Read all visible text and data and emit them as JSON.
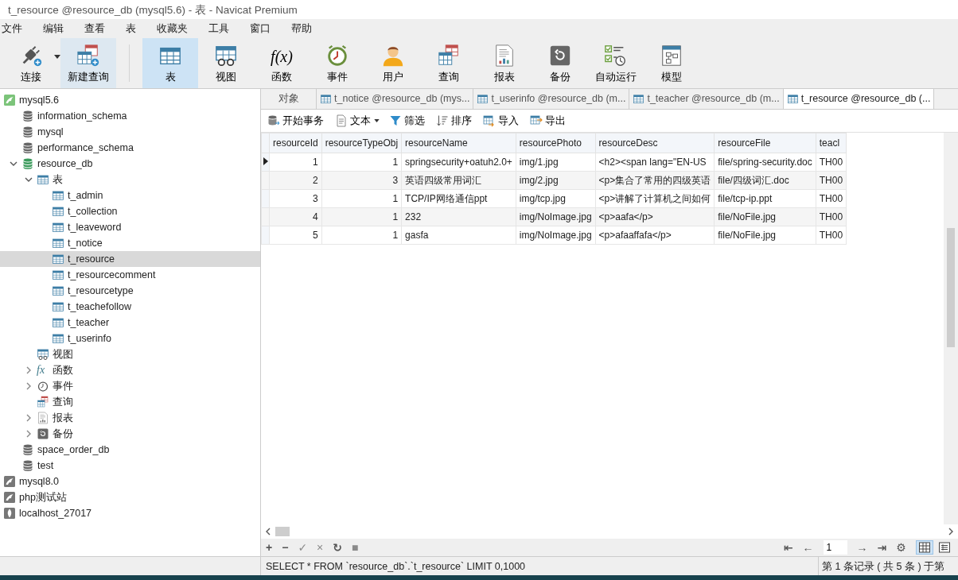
{
  "window": {
    "title": "t_resource @resource_db (mysql5.6) - 表 - Navicat Premium"
  },
  "menu": [
    "文件",
    "编辑",
    "查看",
    "表",
    "收藏夹",
    "工具",
    "窗口",
    "帮助"
  ],
  "toolbar": [
    {
      "kind": "connect",
      "label": "连接",
      "selected": false,
      "dropdown": true
    },
    {
      "kind": "newquery",
      "label": "新建查询",
      "selected": false,
      "highlighted": true
    },
    {
      "kind": "table",
      "label": "表",
      "selected": true
    },
    {
      "kind": "view",
      "label": "视图",
      "selected": false
    },
    {
      "kind": "function",
      "label": "函数",
      "selected": false,
      "glyph": "f(x)"
    },
    {
      "kind": "event",
      "label": "事件",
      "selected": false
    },
    {
      "kind": "user",
      "label": "用户",
      "selected": false
    },
    {
      "kind": "query",
      "label": "查询",
      "selected": false
    },
    {
      "kind": "report",
      "label": "报表",
      "selected": false
    },
    {
      "kind": "backup",
      "label": "备份",
      "selected": false
    },
    {
      "kind": "autorun",
      "label": "自动运行",
      "selected": false
    },
    {
      "kind": "model",
      "label": "模型",
      "selected": false
    }
  ],
  "sidebar": {
    "tree": [
      {
        "kind": "connection",
        "label": "mysql5.6",
        "selected": false,
        "children": [
          {
            "kind": "database",
            "label": "information_schema",
            "selected": false
          },
          {
            "kind": "database",
            "label": "mysql",
            "selected": false
          },
          {
            "kind": "database",
            "label": "performance_schema",
            "selected": false
          },
          {
            "kind": "database",
            "label": "resource_db",
            "selected": false,
            "expanded": true,
            "open": true,
            "children": [
              {
                "kind": "tables",
                "label": "表",
                "selected": false,
                "expanded": true,
                "children": [
                  {
                    "kind": "table",
                    "label": "t_admin",
                    "selected": false
                  },
                  {
                    "kind": "table",
                    "label": "t_collection",
                    "selected": false
                  },
                  {
                    "kind": "table",
                    "label": "t_leaveword",
                    "selected": false
                  },
                  {
                    "kind": "table",
                    "label": "t_notice",
                    "selected": false
                  },
                  {
                    "kind": "table",
                    "label": "t_resource",
                    "selected": true
                  },
                  {
                    "kind": "table",
                    "label": "t_resourcecomment",
                    "selected": false
                  },
                  {
                    "kind": "table",
                    "label": "t_resourcetype",
                    "selected": false
                  },
                  {
                    "kind": "table",
                    "label": "t_teachefollow",
                    "selected": false
                  },
                  {
                    "kind": "table",
                    "label": "t_teacher",
                    "selected": false
                  },
                  {
                    "kind": "table",
                    "label": "t_userinfo",
                    "selected": false
                  }
                ]
              },
              {
                "kind": "views",
                "label": "视图",
                "selected": false
              },
              {
                "kind": "functions",
                "label": "函数",
                "selected": false,
                "expanded": false,
                "glyph": "fx"
              },
              {
                "kind": "events",
                "label": "事件",
                "selected": false,
                "expanded": false
              },
              {
                "kind": "queries",
                "label": "查询",
                "selected": false
              },
              {
                "kind": "reports",
                "label": "报表",
                "selected": false,
                "expanded": false
              },
              {
                "kind": "backups",
                "label": "备份",
                "selected": false,
                "expanded": false
              }
            ]
          },
          {
            "kind": "database",
            "label": "space_order_db",
            "selected": false
          },
          {
            "kind": "database",
            "label": "test",
            "selected": false
          }
        ]
      },
      {
        "kind": "connection-off",
        "label": "mysql8.0",
        "selected": false
      },
      {
        "kind": "connection-off",
        "label": "php测试站",
        "selected": false
      },
      {
        "kind": "mongo",
        "label": "localhost_27017",
        "selected": false
      }
    ]
  },
  "tabs": [
    {
      "kind": "objects",
      "label": "对象",
      "selected": false
    },
    {
      "kind": "table",
      "label": "t_notice @resource_db (mys...",
      "selected": false
    },
    {
      "kind": "table",
      "label": "t_userinfo @resource_db (m...",
      "selected": false
    },
    {
      "kind": "table",
      "label": "t_teacher @resource_db (m...",
      "selected": false
    },
    {
      "kind": "table",
      "label": "t_resource @resource_db (...",
      "selected": true
    }
  ],
  "subtoolbar": [
    {
      "kind": "transaction",
      "label": "开始事务"
    },
    {
      "kind": "text",
      "label": "文本",
      "dropdown": true
    },
    {
      "kind": "filter",
      "label": "筛选"
    },
    {
      "kind": "sort",
      "label": "排序"
    },
    {
      "kind": "import",
      "label": "导入"
    },
    {
      "kind": "export",
      "label": "导出"
    }
  ],
  "table": {
    "columns": [
      "resourceId",
      "resourceTypeObj",
      "resourceName",
      "resourcePhoto",
      "resourceDesc",
      "resourceFile",
      "teacl"
    ],
    "numeric": [
      true,
      true,
      false,
      false,
      false,
      false,
      false
    ],
    "rows": [
      {
        "current": true,
        "cells": [
          "1",
          "1",
          "springsecurity+oatuh2.0+",
          "img/1.jpg",
          "<h2><span lang=\"EN-US",
          "file/spring-security.doc",
          "TH00"
        ]
      },
      {
        "current": false,
        "cells": [
          "2",
          "3",
          "英语四级常用词汇",
          "img/2.jpg",
          "<p>集合了常用的四级英语",
          "file/四级词汇.doc",
          "TH00"
        ]
      },
      {
        "current": false,
        "cells": [
          "3",
          "1",
          "TCP/IP网络通信ppt",
          "img/tcp.jpg",
          "<p>讲解了计算机之间如何",
          "file/tcp-ip.ppt",
          "TH00"
        ]
      },
      {
        "current": false,
        "cells": [
          "4",
          "1",
          "232",
          "img/NoImage.jpg",
          "<p>aafa</p>",
          "file/NoFile.jpg",
          "TH00"
        ]
      },
      {
        "current": false,
        "cells": [
          "5",
          "1",
          "gasfa",
          "img/NoImage.jpg",
          "<p>afaaffafa</p>",
          "file/NoFile.jpg",
          "TH00"
        ]
      }
    ]
  },
  "record_bar": {
    "actions": [
      {
        "glyph": "+",
        "disabled": false
      },
      {
        "glyph": "−",
        "disabled": false
      },
      {
        "glyph": "✓",
        "disabled": true
      },
      {
        "glyph": "×",
        "disabled": true
      },
      {
        "glyph": "↻",
        "disabled": false
      },
      {
        "glyph": "■",
        "disabled": true
      }
    ],
    "nav": [
      {
        "glyph": "⇤"
      },
      {
        "glyph": "←"
      }
    ],
    "page": "1",
    "nav_after": [
      {
        "glyph": "→"
      },
      {
        "glyph": "⇥"
      },
      {
        "glyph": "⚙"
      }
    ],
    "views": [
      {
        "kind": "grid",
        "selected": true
      },
      {
        "kind": "form",
        "selected": false
      }
    ]
  },
  "status_bar": {
    "sql": "SELECT * FROM `resource_db`.`t_resource` LIMIT 0,1000",
    "records": "第 1 条记录 ( 共 5 条 ) 于第"
  }
}
